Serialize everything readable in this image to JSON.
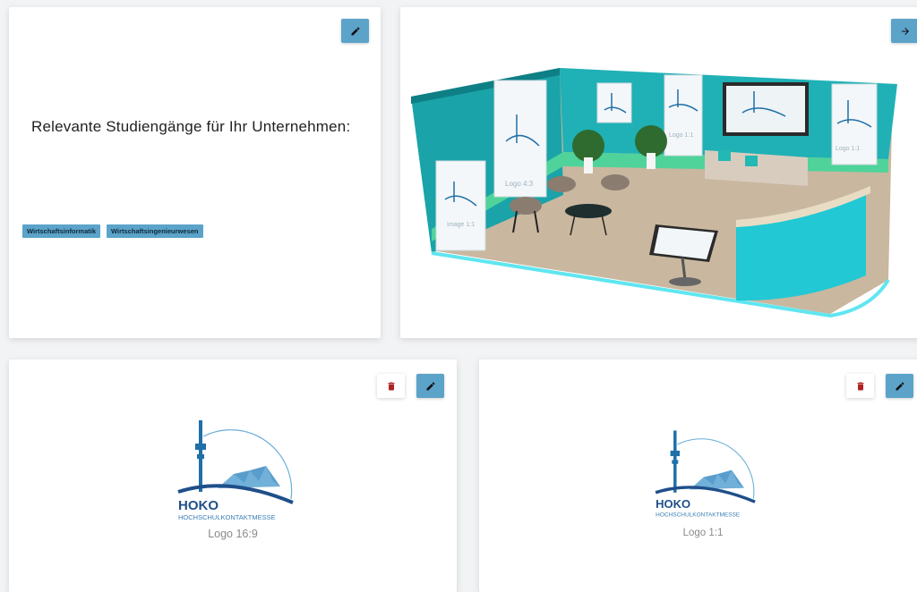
{
  "studies_card": {
    "title": "Relevante Studiengänge für Ihr Unternehmen:",
    "tags": [
      "Wirtschaftsinformatik",
      "Wirtschaftsingenieurwesen"
    ]
  },
  "booth_card": {
    "poster_logo_labels": [
      "Logo 4:3",
      "Logo 1:1",
      "Logo 1:1",
      "Image 1:1"
    ]
  },
  "logo_cards": [
    {
      "brand": "HOKO",
      "brand_sub": "HOCHSCHULKONTAKTMESSE",
      "caption": "Logo 16:9"
    },
    {
      "brand": "HOKO",
      "brand_sub": "HOCHSCHULKONTAKTMESSE",
      "caption": "Logo 1:1"
    }
  ],
  "icons": {
    "edit": "pencil-icon",
    "delete": "trash-icon",
    "navigate": "arrow-right-icon"
  },
  "colors": {
    "accent": "#5ba3c9",
    "danger": "#b22222",
    "booth_teal": "#1aa3a8",
    "logo_blue": "#1f6fa8"
  }
}
